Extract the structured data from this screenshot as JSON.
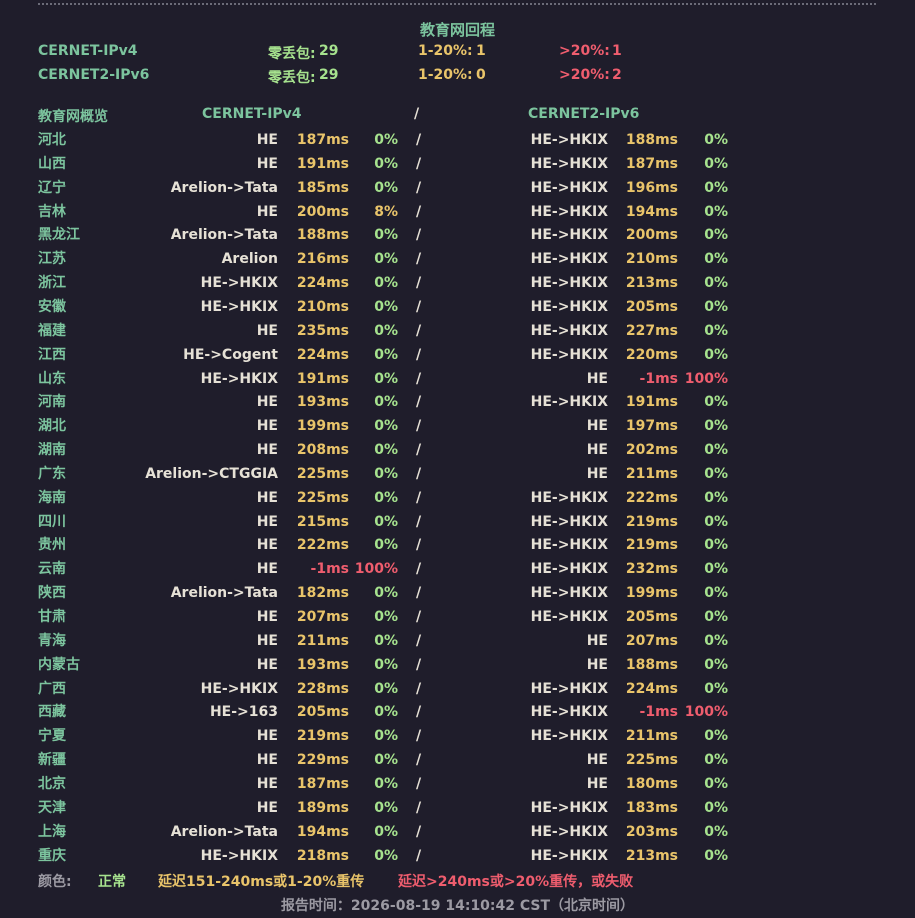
{
  "title": "教育网回程",
  "summary": [
    {
      "name": "CERNET-IPv4",
      "zero_loss_label": "零丢包:",
      "zero_loss": "29",
      "mid_label": "1-20%:",
      "mid": "1",
      "high_label": ">20%:",
      "high": "1"
    },
    {
      "name": "CERNET2-IPv6",
      "zero_loss_label": "零丢包:",
      "zero_loss": "29",
      "mid_label": "1-20%:",
      "mid": "0",
      "high_label": ">20%:",
      "high": "2"
    }
  ],
  "header": {
    "overview": "教育网概览",
    "ipv4": "CERNET-IPv4",
    "sep": "/",
    "ipv6": "CERNET2-IPv6"
  },
  "rows": [
    {
      "prov": "河北",
      "r4": "HE",
      "l4": "187ms",
      "p4": "0%",
      "r6": "HE->HKIX",
      "l6": "188ms",
      "p6": "0%"
    },
    {
      "prov": "山西",
      "r4": "HE",
      "l4": "191ms",
      "p4": "0%",
      "r6": "HE->HKIX",
      "l6": "187ms",
      "p6": "0%"
    },
    {
      "prov": "辽宁",
      "r4": "Arelion->Tata",
      "l4": "185ms",
      "p4": "0%",
      "r6": "HE->HKIX",
      "l6": "196ms",
      "p6": "0%"
    },
    {
      "prov": "吉林",
      "r4": "HE",
      "l4": "200ms",
      "p4": "8%",
      "r6": "HE->HKIX",
      "l6": "194ms",
      "p6": "0%"
    },
    {
      "prov": "黑龙江",
      "r4": "Arelion->Tata",
      "l4": "188ms",
      "p4": "0%",
      "r6": "HE->HKIX",
      "l6": "200ms",
      "p6": "0%"
    },
    {
      "prov": "江苏",
      "r4": "Arelion",
      "l4": "216ms",
      "p4": "0%",
      "r6": "HE->HKIX",
      "l6": "210ms",
      "p6": "0%"
    },
    {
      "prov": "浙江",
      "r4": "HE->HKIX",
      "l4": "224ms",
      "p4": "0%",
      "r6": "HE->HKIX",
      "l6": "213ms",
      "p6": "0%"
    },
    {
      "prov": "安徽",
      "r4": "HE->HKIX",
      "l4": "210ms",
      "p4": "0%",
      "r6": "HE->HKIX",
      "l6": "205ms",
      "p6": "0%"
    },
    {
      "prov": "福建",
      "r4": "HE",
      "l4": "235ms",
      "p4": "0%",
      "r6": "HE->HKIX",
      "l6": "227ms",
      "p6": "0%"
    },
    {
      "prov": "江西",
      "r4": "HE->Cogent",
      "l4": "224ms",
      "p4": "0%",
      "r6": "HE->HKIX",
      "l6": "220ms",
      "p6": "0%"
    },
    {
      "prov": "山东",
      "r4": "HE->HKIX",
      "l4": "191ms",
      "p4": "0%",
      "r6": "HE",
      "l6": "-1ms",
      "p6": "100%"
    },
    {
      "prov": "河南",
      "r4": "HE",
      "l4": "193ms",
      "p4": "0%",
      "r6": "HE->HKIX",
      "l6": "191ms",
      "p6": "0%"
    },
    {
      "prov": "湖北",
      "r4": "HE",
      "l4": "199ms",
      "p4": "0%",
      "r6": "HE",
      "l6": "197ms",
      "p6": "0%"
    },
    {
      "prov": "湖南",
      "r4": "HE",
      "l4": "208ms",
      "p4": "0%",
      "r6": "HE",
      "l6": "202ms",
      "p6": "0%"
    },
    {
      "prov": "广东",
      "r4": "Arelion->CTGGIA",
      "l4": "225ms",
      "p4": "0%",
      "r6": "HE",
      "l6": "211ms",
      "p6": "0%"
    },
    {
      "prov": "海南",
      "r4": "HE",
      "l4": "225ms",
      "p4": "0%",
      "r6": "HE->HKIX",
      "l6": "222ms",
      "p6": "0%"
    },
    {
      "prov": "四川",
      "r4": "HE",
      "l4": "215ms",
      "p4": "0%",
      "r6": "HE->HKIX",
      "l6": "219ms",
      "p6": "0%"
    },
    {
      "prov": "贵州",
      "r4": "HE",
      "l4": "222ms",
      "p4": "0%",
      "r6": "HE->HKIX",
      "l6": "219ms",
      "p6": "0%"
    },
    {
      "prov": "云南",
      "r4": "HE",
      "l4": "-1ms",
      "p4": "100%",
      "r6": "HE->HKIX",
      "l6": "232ms",
      "p6": "0%"
    },
    {
      "prov": "陕西",
      "r4": "Arelion->Tata",
      "l4": "182ms",
      "p4": "0%",
      "r6": "HE->HKIX",
      "l6": "199ms",
      "p6": "0%"
    },
    {
      "prov": "甘肃",
      "r4": "HE",
      "l4": "207ms",
      "p4": "0%",
      "r6": "HE->HKIX",
      "l6": "205ms",
      "p6": "0%"
    },
    {
      "prov": "青海",
      "r4": "HE",
      "l4": "211ms",
      "p4": "0%",
      "r6": "HE",
      "l6": "207ms",
      "p6": "0%"
    },
    {
      "prov": "内蒙古",
      "r4": "HE",
      "l4": "193ms",
      "p4": "0%",
      "r6": "HE",
      "l6": "188ms",
      "p6": "0%"
    },
    {
      "prov": "广西",
      "r4": "HE->HKIX",
      "l4": "228ms",
      "p4": "0%",
      "r6": "HE->HKIX",
      "l6": "224ms",
      "p6": "0%"
    },
    {
      "prov": "西藏",
      "r4": "HE->163",
      "l4": "205ms",
      "p4": "0%",
      "r6": "HE->HKIX",
      "l6": "-1ms",
      "p6": "100%"
    },
    {
      "prov": "宁夏",
      "r4": "HE",
      "l4": "219ms",
      "p4": "0%",
      "r6": "HE->HKIX",
      "l6": "211ms",
      "p6": "0%"
    },
    {
      "prov": "新疆",
      "r4": "HE",
      "l4": "229ms",
      "p4": "0%",
      "r6": "HE",
      "l6": "225ms",
      "p6": "0%"
    },
    {
      "prov": "北京",
      "r4": "HE",
      "l4": "187ms",
      "p4": "0%",
      "r6": "HE",
      "l6": "180ms",
      "p6": "0%"
    },
    {
      "prov": "天津",
      "r4": "HE",
      "l4": "189ms",
      "p4": "0%",
      "r6": "HE->HKIX",
      "l6": "183ms",
      "p6": "0%"
    },
    {
      "prov": "上海",
      "r4": "Arelion->Tata",
      "l4": "194ms",
      "p4": "0%",
      "r6": "HE->HKIX",
      "l6": "203ms",
      "p6": "0%"
    },
    {
      "prov": "重庆",
      "r4": "HE->HKIX",
      "l4": "218ms",
      "p4": "0%",
      "r6": "HE->HKIX",
      "l6": "213ms",
      "p6": "0%"
    }
  ],
  "legend": {
    "label": "颜色:",
    "normal": "正常",
    "warn": "延迟151-240ms或1-20%重传",
    "bad": "延迟>240ms或>20%重传，或失败"
  },
  "footer": "报告时间：2026-08-19 14:10:42 CST（北京时间）",
  "colors": {
    "background": "#1f1d2b",
    "good": "#a6e28e",
    "warn": "#e9c46a",
    "bad": "#ef5d6e",
    "label": "#7cc49e"
  }
}
